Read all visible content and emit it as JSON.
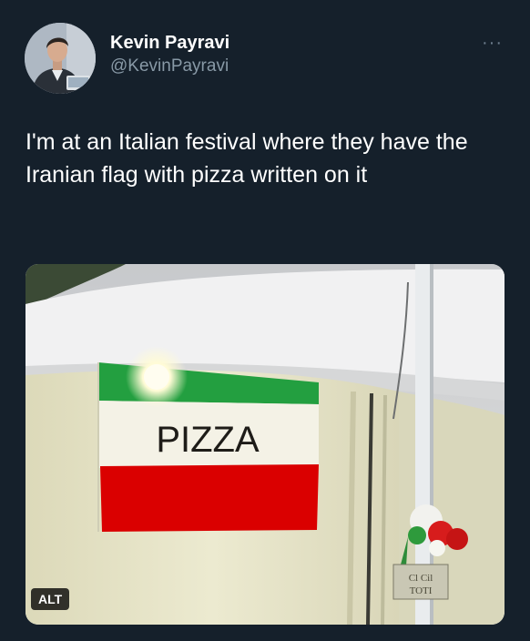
{
  "tweet": {
    "author": {
      "display_name": "Kevin Payravi",
      "handle": "@KevinPayravi",
      "avatar_icon": "user-avatar"
    },
    "more_icon": "ellipsis-icon",
    "more_label": "···",
    "text": "I'm at an Italian festival where they have the Iranian flag with pizza written on it",
    "media": {
      "flag_text": "PIZZA",
      "sign_text_line1": "Cl Cil",
      "sign_text_line2": "TOTI",
      "alt_badge": "ALT",
      "colors": {
        "flag_green": "#239f40",
        "flag_red": "#da0000",
        "tent": "#e8e6c8"
      }
    }
  }
}
